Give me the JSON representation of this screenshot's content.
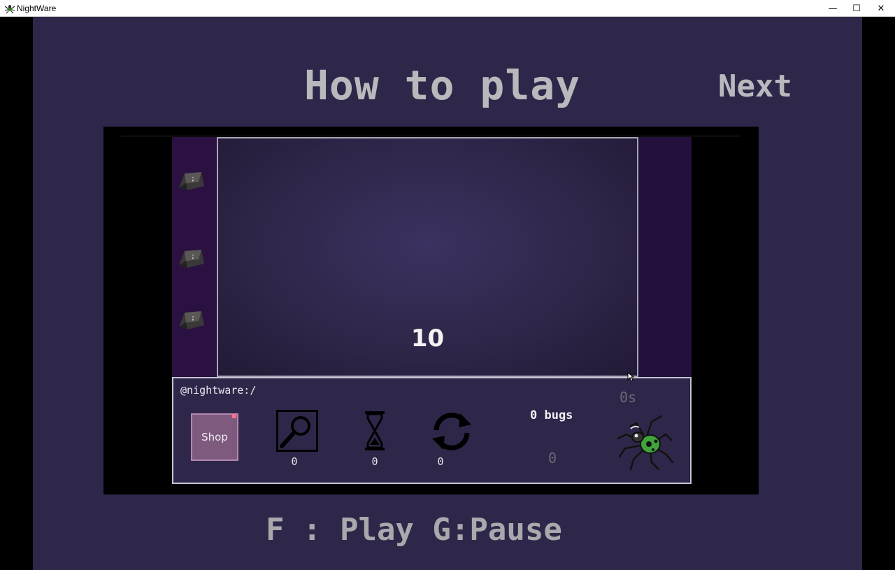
{
  "window": {
    "title": "NightWare",
    "minimize_label": "—",
    "maximize_label": "☐",
    "close_label": "✕"
  },
  "screen": {
    "heading": "How to play",
    "next_label": "Next",
    "controls_hint": "F : Play G:Pause"
  },
  "demo": {
    "countdown": "10",
    "prompt": "@nightware:/",
    "shop_label": "Shop",
    "search_count": "0",
    "time_count": "0",
    "refresh_count": "0",
    "bugs_label": "0 bugs",
    "bugs_value": "0",
    "timer": "0s"
  },
  "icons": {
    "app": "spider-icon",
    "keys": "semicolon-key-icon",
    "search": "magnifier-icon",
    "time": "hourglass-icon",
    "refresh": "refresh-icon",
    "mascot": "spider-bug-icon"
  },
  "colors": {
    "background": "#2f2749",
    "text": "#b9b9bd",
    "key_column": "#2a1141",
    "shop": "#7e5b7e",
    "spider": "#3fa43a"
  }
}
